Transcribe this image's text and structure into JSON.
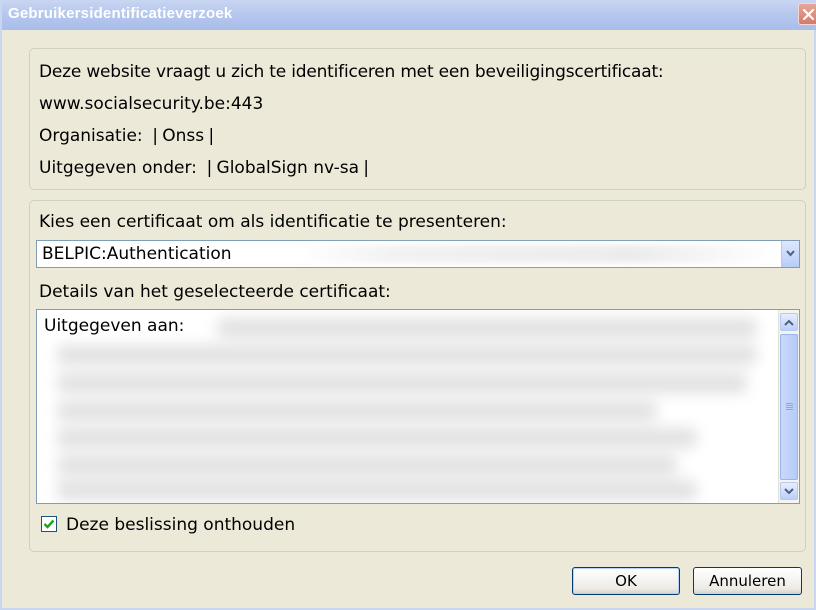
{
  "window": {
    "title": "Gebruikersidentificatieverzoek"
  },
  "info": {
    "request_text": "Deze website vraagt u zich te identificeren met een beveiligingscertificaat:",
    "host": "www.socialsecurity.be:443",
    "organisation": "Organisatie: ❘Onss❘",
    "issued_under": "Uitgegeven onder: ❘GlobalSign nv-sa❘"
  },
  "certificate": {
    "choose_label": "Kies een certificaat om als identificatie te presenteren:",
    "selected_value": "BELPIC:Authentication",
    "details_label": "Details van het geselecteerde certificaat:",
    "issued_to_label": "Uitgegeven aan:"
  },
  "remember": {
    "label": "Deze beslissing onthouden",
    "checked": true
  },
  "buttons": {
    "ok": "OK",
    "cancel": "Annuleren"
  },
  "colors": {
    "titlebar": "#b7c8ee",
    "dialog_bg": "#ece9d8",
    "input_border": "#7f9db9",
    "button_border": "#003c74",
    "checkmark": "#21a121"
  },
  "icons": {
    "close": "close-icon",
    "dropdown": "chevron-down-icon",
    "scroll_up": "arrow-up-icon",
    "scroll_down": "arrow-down-icon",
    "check": "checkmark-icon"
  }
}
